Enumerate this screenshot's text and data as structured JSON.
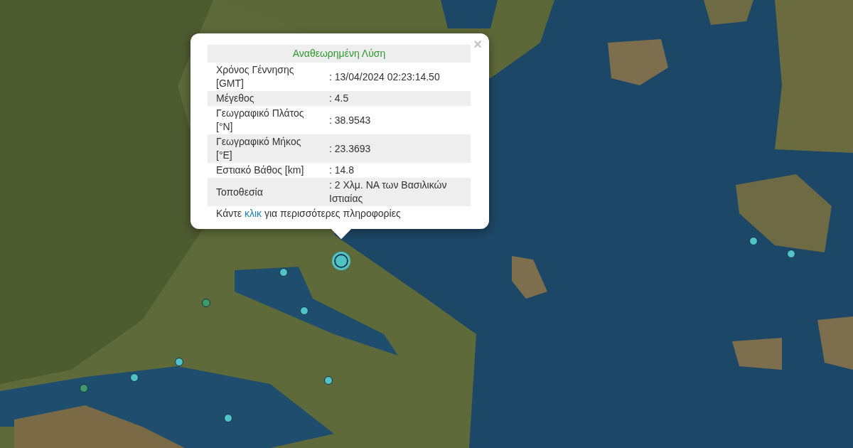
{
  "map": {
    "markers": [
      {
        "color": "#4fc3c8",
        "major": true
      },
      {
        "color": "#4fc3c8",
        "major": false
      },
      {
        "color": "#3f9a6a",
        "major": false
      },
      {
        "color": "#4fc3c8",
        "major": false
      },
      {
        "color": "#4fc3c8",
        "major": false
      },
      {
        "color": "#4fc3c8",
        "major": false
      },
      {
        "color": "#3f9a6a",
        "major": false
      },
      {
        "color": "#4fc3c8",
        "major": false
      },
      {
        "color": "#4fc3c8",
        "major": false
      },
      {
        "color": "#4fc3c8",
        "major": false
      },
      {
        "color": "#4fc3c8",
        "major": false
      }
    ]
  },
  "popup": {
    "close": "×",
    "title": "Αναθεωρημένη Λύση",
    "rows": [
      {
        "label": "Χρόνος Γέννησης [GMT]",
        "value": ": 13/04/2024 02:23:14.50"
      },
      {
        "label": "Μέγεθος",
        "value": ": 4.5"
      },
      {
        "label": "Γεωγραφικό Πλάτος [°N]",
        "value": ": 38.9543"
      },
      {
        "label": "Γεωγραφικό Μήκος [°E]",
        "value": ": 23.3693"
      },
      {
        "label": "Εστιακό Βάθος [km]",
        "value": ": 14.8"
      },
      {
        "label": "Τοποθεσία",
        "value": ": 2 Χλμ. ΝΑ των Βασιλικών Ιστιαίας"
      }
    ],
    "footer": {
      "before": "Κάντε",
      "link": "κλικ",
      "after": "για περισσότερες πληροφορίες"
    }
  }
}
